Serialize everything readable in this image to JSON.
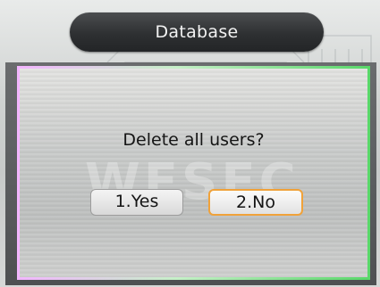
{
  "header": {
    "title": "Database"
  },
  "dialog": {
    "message": "Delete all users?",
    "watermark": "WESEC",
    "buttons": [
      {
        "label": "1.Yes",
        "selected": false
      },
      {
        "label": "2.No",
        "selected": true
      }
    ]
  },
  "colors": {
    "title_bar": "#2e3032",
    "title_text": "#f2f2f2",
    "selected_border": "#f0a23a",
    "dialog_border_left": "#f3b6ff",
    "dialog_border_right": "#59d86a"
  }
}
